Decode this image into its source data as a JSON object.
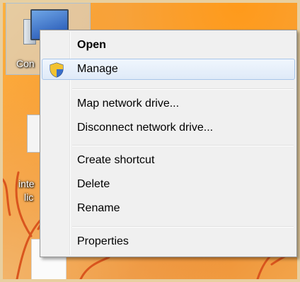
{
  "desktop": {
    "computer_icon_label": "Con",
    "doc_icon_label_line1": "inte",
    "doc_icon_label_line2": "lic"
  },
  "context_menu": {
    "items": [
      {
        "label": "Open",
        "bold": true
      },
      {
        "label": "Manage",
        "icon": "uac-shield-icon",
        "highlighted": true
      },
      {
        "label": "Map network drive..."
      },
      {
        "label": "Disconnect network drive..."
      },
      {
        "label": "Create shortcut"
      },
      {
        "label": "Delete"
      },
      {
        "label": "Rename"
      },
      {
        "label": "Properties"
      }
    ]
  },
  "colors": {
    "menu_background": "#f0f0f0",
    "highlight_border": "#a8c6ea",
    "wallpaper_orange": "#f79426"
  }
}
